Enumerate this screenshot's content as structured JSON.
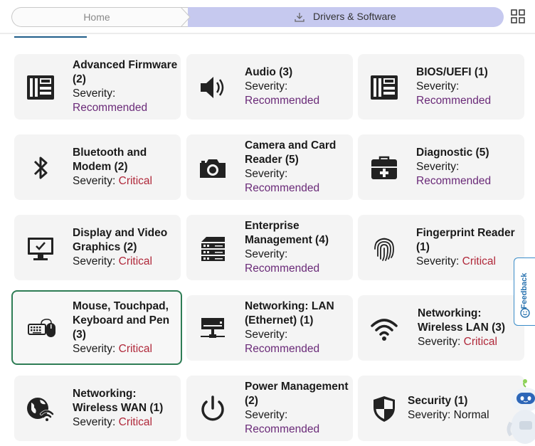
{
  "breadcrumb": {
    "home_label": "Home",
    "current_label": "Drivers & Software"
  },
  "feedback": {
    "label": "Feedback"
  },
  "severity_label": "Severity:",
  "categories": [
    {
      "title": "Advanced Firmware (2)",
      "severity": "Recommended",
      "icon": "circuit-board-icon"
    },
    {
      "title": "Audio (3)",
      "severity": "Recommended",
      "icon": "speaker-icon"
    },
    {
      "title": "BIOS/UEFI (1)",
      "severity": "Recommended",
      "icon": "circuit-board-icon"
    },
    {
      "title": "Bluetooth and Modem (2)",
      "severity": "Critical",
      "icon": "bluetooth-icon"
    },
    {
      "title": "Camera and Card Reader (5)",
      "severity": "Recommended",
      "icon": "camera-icon"
    },
    {
      "title": "Diagnostic (5)",
      "severity": "Recommended",
      "icon": "toolbox-icon"
    },
    {
      "title": "Display and Video Graphics (2)",
      "severity": "Critical",
      "icon": "monitor-icon"
    },
    {
      "title": "Enterprise Management (4)",
      "severity": "Recommended",
      "icon": "server-icon"
    },
    {
      "title": "Fingerprint Reader (1)",
      "severity": "Critical",
      "icon": "fingerprint-icon"
    },
    {
      "title": "Mouse, Touchpad, Keyboard and Pen (3)",
      "severity": "Critical",
      "icon": "keyboard-mouse-icon"
    },
    {
      "title": "Networking: LAN (Ethernet) (1)",
      "severity": "Recommended",
      "icon": "network-drive-icon"
    },
    {
      "title": "Networking: Wireless LAN (3)",
      "severity": "Critical",
      "icon": "wifi-icon"
    },
    {
      "title": "Networking: Wireless WAN (1)",
      "severity": "Critical",
      "icon": "globe-wifi-icon"
    },
    {
      "title": "Power Management (2)",
      "severity": "Recommended",
      "icon": "power-icon"
    },
    {
      "title": "Security (1)",
      "severity": "Normal",
      "icon": "shield-icon"
    }
  ],
  "colors": {
    "recommended": "#6a2a78",
    "critical": "#b0283a",
    "breadcrumb_active": "#c6c9ef",
    "selected_border": "#2e7d55"
  }
}
